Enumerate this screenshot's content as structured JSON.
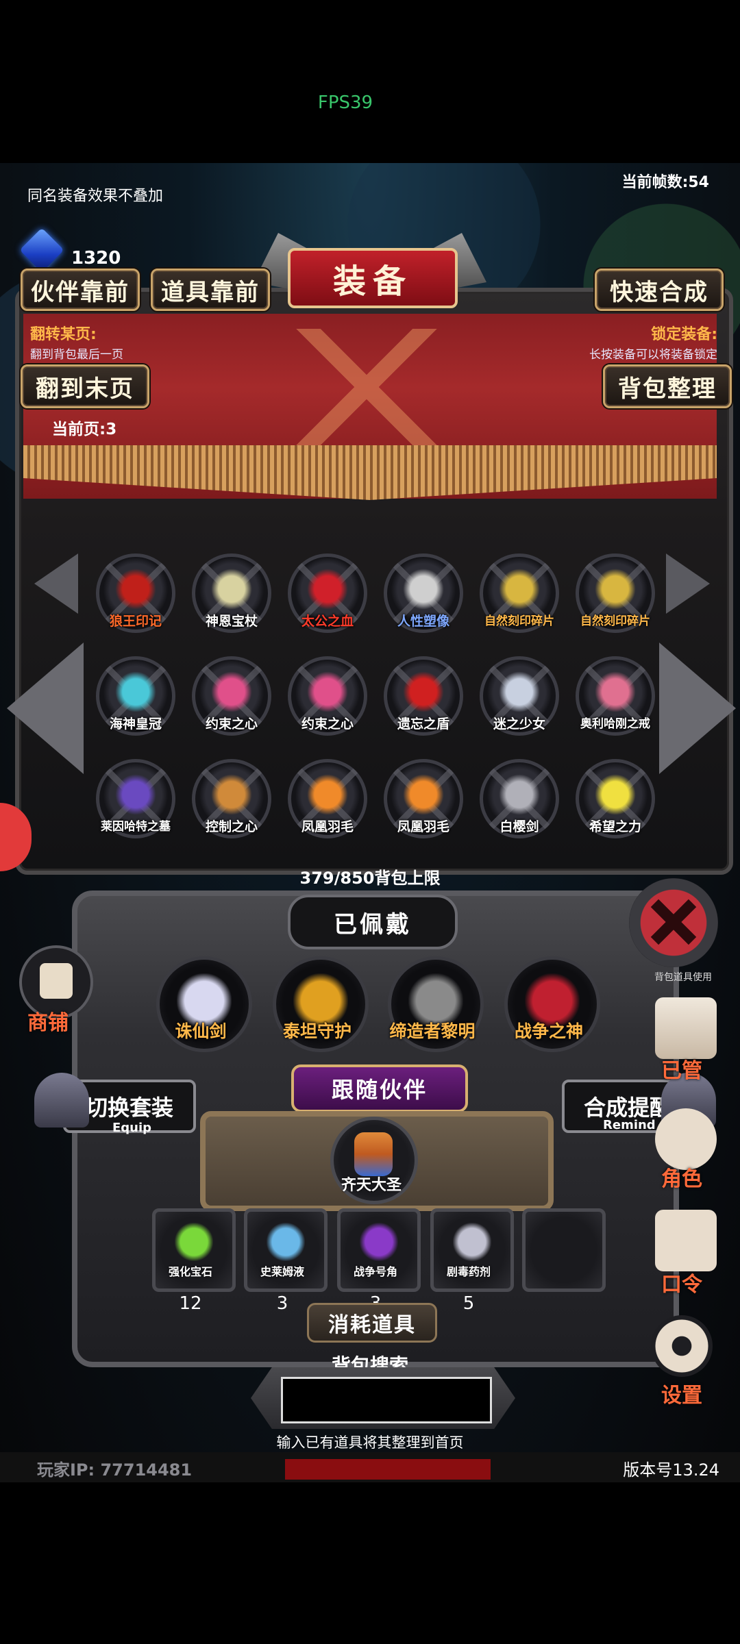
{
  "fps": "FPS39",
  "top": {
    "note": "同名装备效果不叠加",
    "frames": "当前帧数:54",
    "gems": "1320"
  },
  "title": "装备",
  "buttons": {
    "partner_first": "伙伴靠前",
    "items_first": "道具靠前",
    "quick_merge": "快速合成",
    "last_page": "翻到末页",
    "sort_bag": "背包整理",
    "switch_set": "切换套装",
    "switch_set_sub": "Equip",
    "merge_remind": "合成提醒",
    "merge_remind_sub": "Remind"
  },
  "notes": {
    "flip_title": "翻转某页:",
    "flip_desc": "翻到背包最后一页",
    "lock_title": "锁定装备:",
    "lock_desc": "长按装备可以将装备锁定",
    "current_page": "当前页:3"
  },
  "inventory": {
    "rows": [
      [
        {
          "name": "狼王印记",
          "color": "#ff6a2a",
          "icon": "wolf-seal-icon",
          "tint": "#c0201a"
        },
        {
          "name": "神恩宝杖",
          "color": "#ffffff",
          "icon": "staff-icon",
          "tint": "#d8d2a0"
        },
        {
          "name": "太公之血",
          "color": "#ff3b2a",
          "icon": "blood-potion-icon",
          "tint": "#d0202a"
        },
        {
          "name": "人性塑像",
          "color": "#7fa8ff",
          "icon": "statue-icon",
          "tint": "#cfcfcf"
        },
        {
          "name": "自然刻印碎片",
          "color": "#ffb84a",
          "icon": "nature-shard-icon",
          "tint": "#d8b640"
        },
        {
          "name": "自然刻印碎片",
          "color": "#ffb84a",
          "icon": "nature-shard-icon",
          "tint": "#d8b640"
        }
      ],
      [
        {
          "name": "海神皇冠",
          "color": "#ffffff",
          "icon": "crown-icon",
          "tint": "#4ac8d8"
        },
        {
          "name": "约束之心",
          "color": "#ffffff",
          "icon": "heart-icon",
          "tint": "#e0508a"
        },
        {
          "name": "约束之心",
          "color": "#ffffff",
          "icon": "heart-icon",
          "tint": "#e0508a"
        },
        {
          "name": "遗忘之盾",
          "color": "#ffffff",
          "icon": "shield-icon",
          "tint": "#d02020"
        },
        {
          "name": "迷之少女",
          "color": "#ffffff",
          "icon": "girl-icon",
          "tint": "#c8d0e0"
        },
        {
          "name": "奥利哈刚之戒",
          "color": "#ffffff",
          "icon": "ring-icon",
          "tint": "#e07090"
        }
      ],
      [
        {
          "name": "莱因哈特之墓",
          "color": "#ffffff",
          "icon": "tomb-icon",
          "tint": "#6a4ac0"
        },
        {
          "name": "控制之心",
          "color": "#ffffff",
          "icon": "control-heart-icon",
          "tint": "#d08a3a"
        },
        {
          "name": "凤凰羽毛",
          "color": "#ffffff",
          "icon": "feather-icon",
          "tint": "#f08a2a"
        },
        {
          "name": "凤凰羽毛",
          "color": "#ffffff",
          "icon": "feather-icon",
          "tint": "#f08a2a"
        },
        {
          "name": "白樱剑",
          "color": "#ffffff",
          "icon": "sword-icon",
          "tint": "#b0b0b8"
        },
        {
          "name": "希望之力",
          "color": "#ffffff",
          "icon": "star-icon",
          "tint": "#f0e040"
        }
      ]
    ],
    "capacity": "379/850背包上限"
  },
  "equipped": {
    "title": "已佩戴",
    "items": [
      {
        "name": "诛仙剑",
        "icon": "sword-icon",
        "tint": "#d8d8f0"
      },
      {
        "name": "泰坦守护",
        "icon": "titan-armor-icon",
        "tint": "#e0a020"
      },
      {
        "name": "缔造者黎明",
        "icon": "great-sword-icon",
        "tint": "#8a8a8a"
      },
      {
        "name": "战争之神",
        "icon": "war-god-icon",
        "tint": "#c02030"
      }
    ]
  },
  "partner": {
    "title": "跟随伙伴",
    "name": "齐天大圣"
  },
  "consumables": {
    "title": "消耗道具",
    "items": [
      {
        "name": "强化宝石",
        "count": "12",
        "tint": "#7ad83a"
      },
      {
        "name": "史莱姆液",
        "count": "3",
        "tint": "#6ab8e8"
      },
      {
        "name": "战争号角",
        "count": "3",
        "tint": "#8a3ac8"
      },
      {
        "name": "剧毒药剂",
        "count": "5",
        "tint": "#c0c0d0"
      }
    ]
  },
  "search": {
    "title": "背包搜索",
    "hint": "输入已有道具将其整理到首页",
    "value": ""
  },
  "side": {
    "shop": "商铺",
    "manage": "已管",
    "role": "角色",
    "code": "口令",
    "settings": "设置",
    "close_hint": "背包道具使用"
  },
  "footer": {
    "player_ip": "玩家IP: 77714481",
    "version": "版本号13.24"
  }
}
